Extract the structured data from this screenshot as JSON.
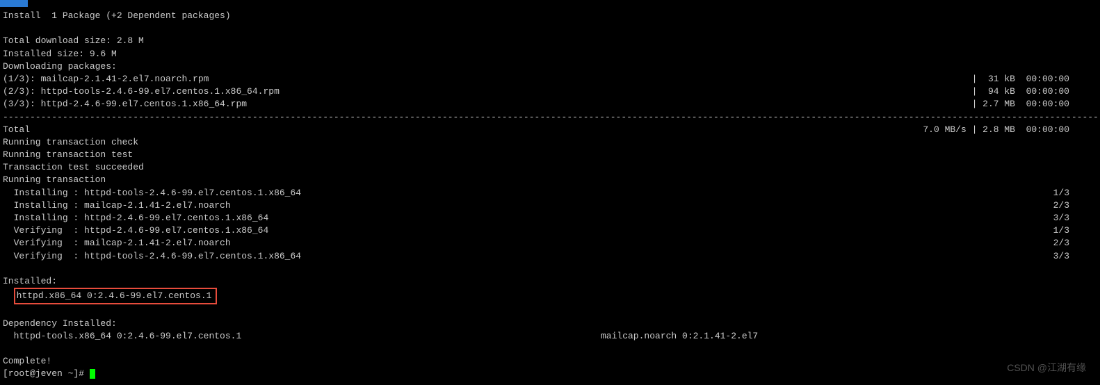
{
  "tab": {
    "label": ""
  },
  "summary": {
    "install_line": "Install  1 Package (+2 Dependent packages)",
    "dl_size": "Total download size: 2.8 M",
    "inst_size": "Installed size: 9.6 M",
    "dl_heading": "Downloading packages:"
  },
  "downloads": [
    {
      "left": "(1/3): mailcap-2.1.41-2.el7.noarch.rpm",
      "right": "|  31 kB  00:00:00"
    },
    {
      "left": "(2/3): httpd-tools-2.4.6-99.el7.centos.1.x86_64.rpm",
      "right": "|  94 kB  00:00:00"
    },
    {
      "left": "(3/3): httpd-2.4.6-99.el7.centos.1.x86_64.rpm",
      "right": "| 2.7 MB  00:00:00"
    }
  ],
  "total_line": {
    "left": "Total",
    "right": "7.0 MB/s | 2.8 MB  00:00:00"
  },
  "trans": {
    "check": "Running transaction check",
    "test": "Running transaction test",
    "succeeded": "Transaction test succeeded",
    "run": "Running transaction"
  },
  "steps": [
    {
      "left": "  Installing : httpd-tools-2.4.6-99.el7.centos.1.x86_64",
      "right": "1/3"
    },
    {
      "left": "  Installing : mailcap-2.1.41-2.el7.noarch",
      "right": "2/3"
    },
    {
      "left": "  Installing : httpd-2.4.6-99.el7.centos.1.x86_64",
      "right": "3/3"
    },
    {
      "left": "  Verifying  : httpd-2.4.6-99.el7.centos.1.x86_64",
      "right": "1/3"
    },
    {
      "left": "  Verifying  : mailcap-2.1.41-2.el7.noarch",
      "right": "2/3"
    },
    {
      "left": "  Verifying  : httpd-tools-2.4.6-99.el7.centos.1.x86_64",
      "right": "3/3"
    }
  ],
  "installed": {
    "heading": "Installed:",
    "pkg": "httpd.x86_64 0:2.4.6-99.el7.centos.1"
  },
  "dep_installed": {
    "heading": "Dependency Installed:",
    "pkg1": "  httpd-tools.x86_64 0:2.4.6-99.el7.centos.1",
    "pkg2": "mailcap.noarch 0:2.1.41-2.el7"
  },
  "complete": "Complete!",
  "prompt": "[root@jeven ~]# ",
  "watermark": "CSDN @江湖有缘",
  "dashes": "--------------------------------------------------------------------------------------------------------------------------------------------------------------------------------------------------------------------------------------------------------------------------------------"
}
